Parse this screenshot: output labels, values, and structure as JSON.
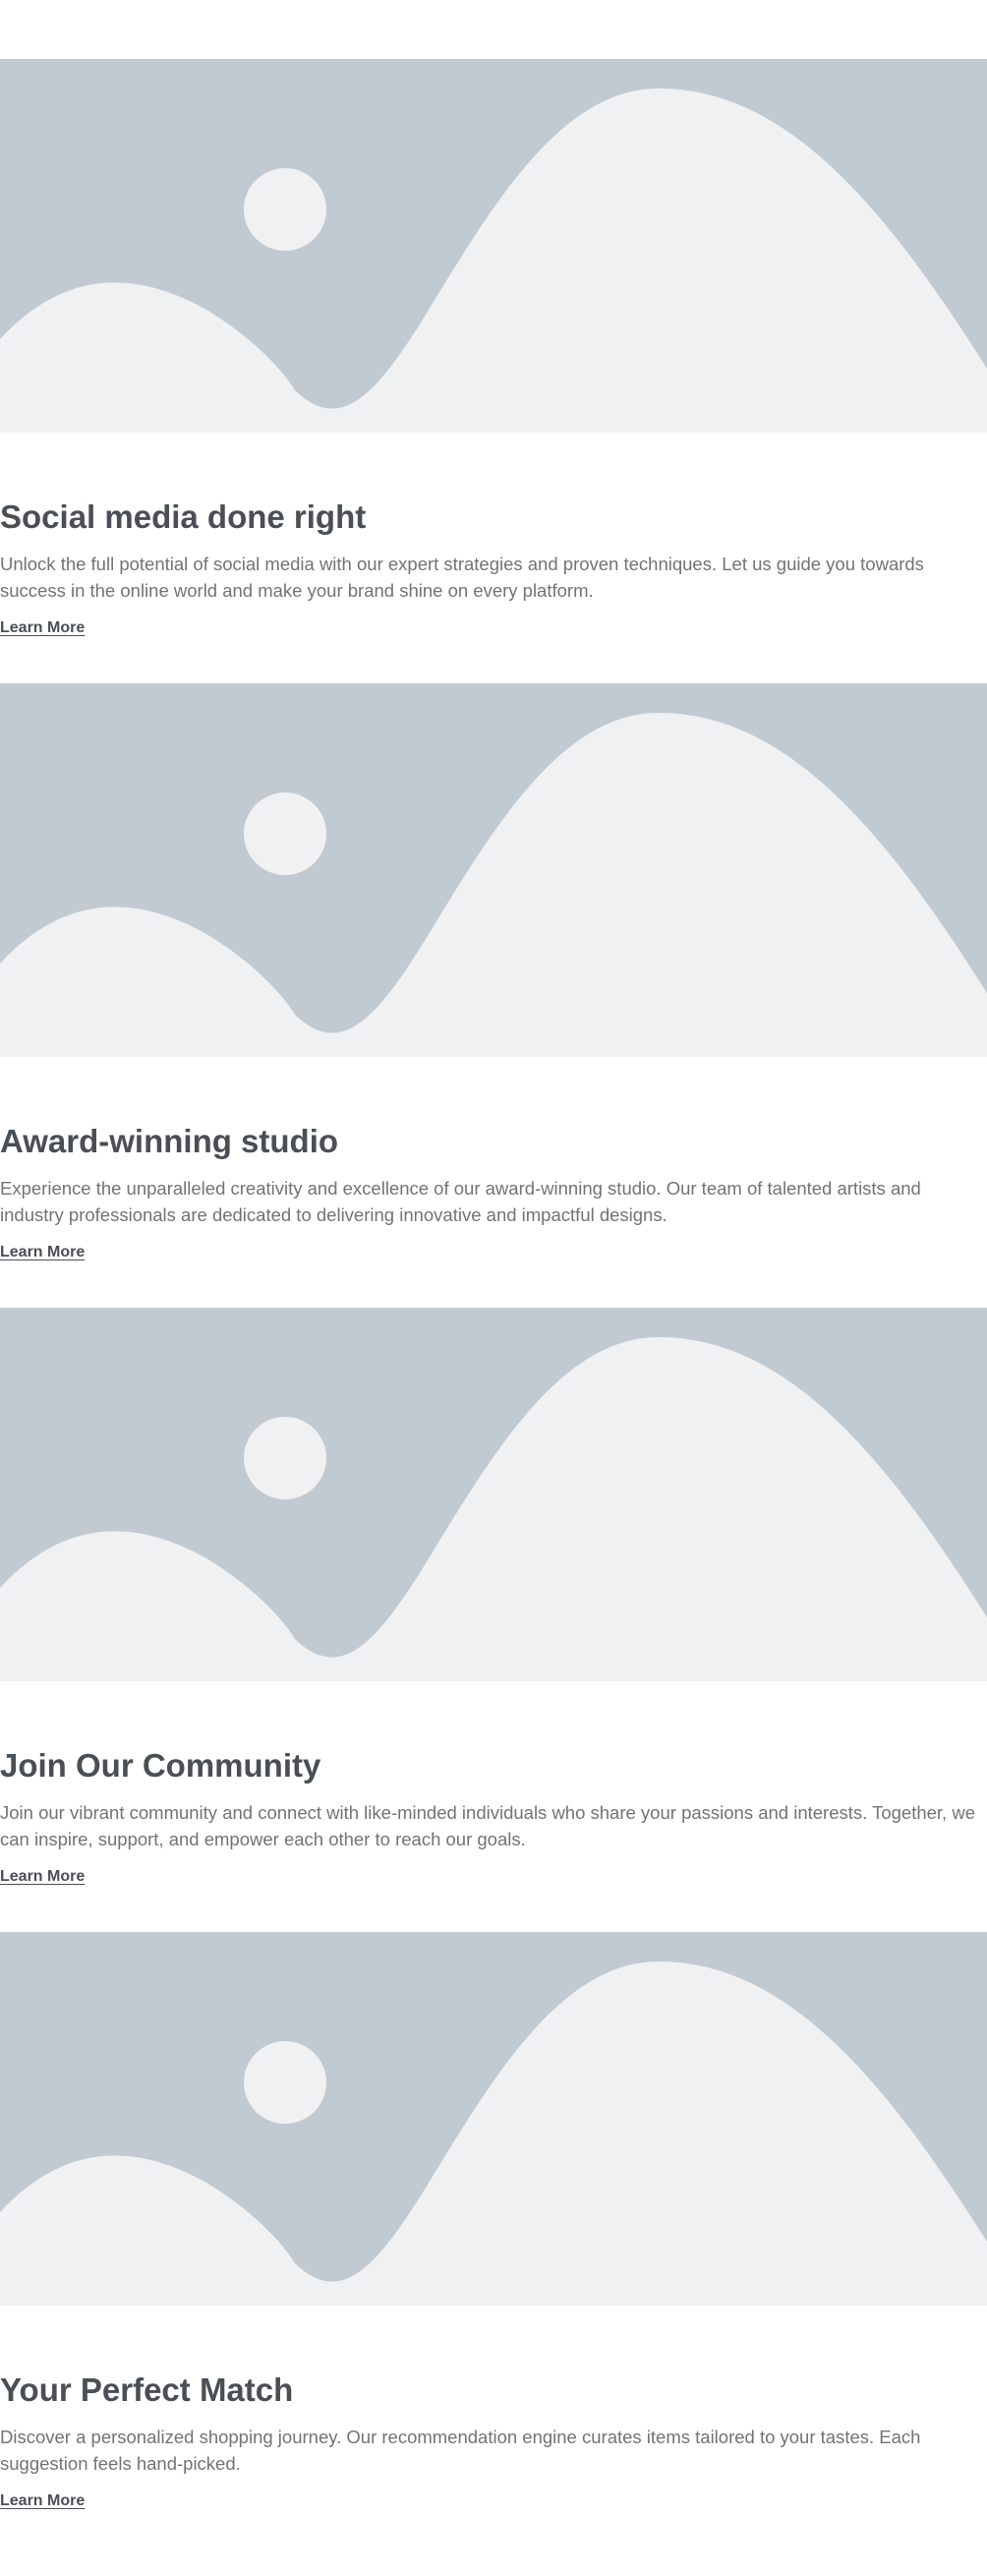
{
  "features": [
    {
      "image_icon": "image-placeholder-icon",
      "title": "Social media done right",
      "text": "Unlock the full potential of social media with our expert strategies and proven techniques. Let us guide you towards success in the online world and make your brand shine on every platform.",
      "link": "Learn More"
    },
    {
      "image_icon": "image-placeholder-icon",
      "title": "Award-winning studio",
      "text": "Experience the unparalleled creativity and excellence of our award-winning studio. Our team of talented artists and industry professionals are dedicated to delivering innovative and impactful designs.",
      "link": "Learn More"
    },
    {
      "image_icon": "image-placeholder-icon",
      "title": "Join Our Community",
      "text": "Join our vibrant community and connect with like-minded individuals who share your passions and interests. Together, we can inspire, support, and empower each other to reach our goals.",
      "link": "Learn More"
    },
    {
      "image_icon": "image-placeholder-icon",
      "title": "Your Perfect Match",
      "text": "Discover a personalized shopping journey. Our recommendation engine curates items tailored to your tastes. Each suggestion feels hand-picked.",
      "link": "Learn More"
    }
  ],
  "colors": {
    "placeholder_back": "#c2cad1",
    "placeholder_front": "#f0f1f2",
    "heading": "#4a4f55",
    "body_text": "#737373"
  }
}
